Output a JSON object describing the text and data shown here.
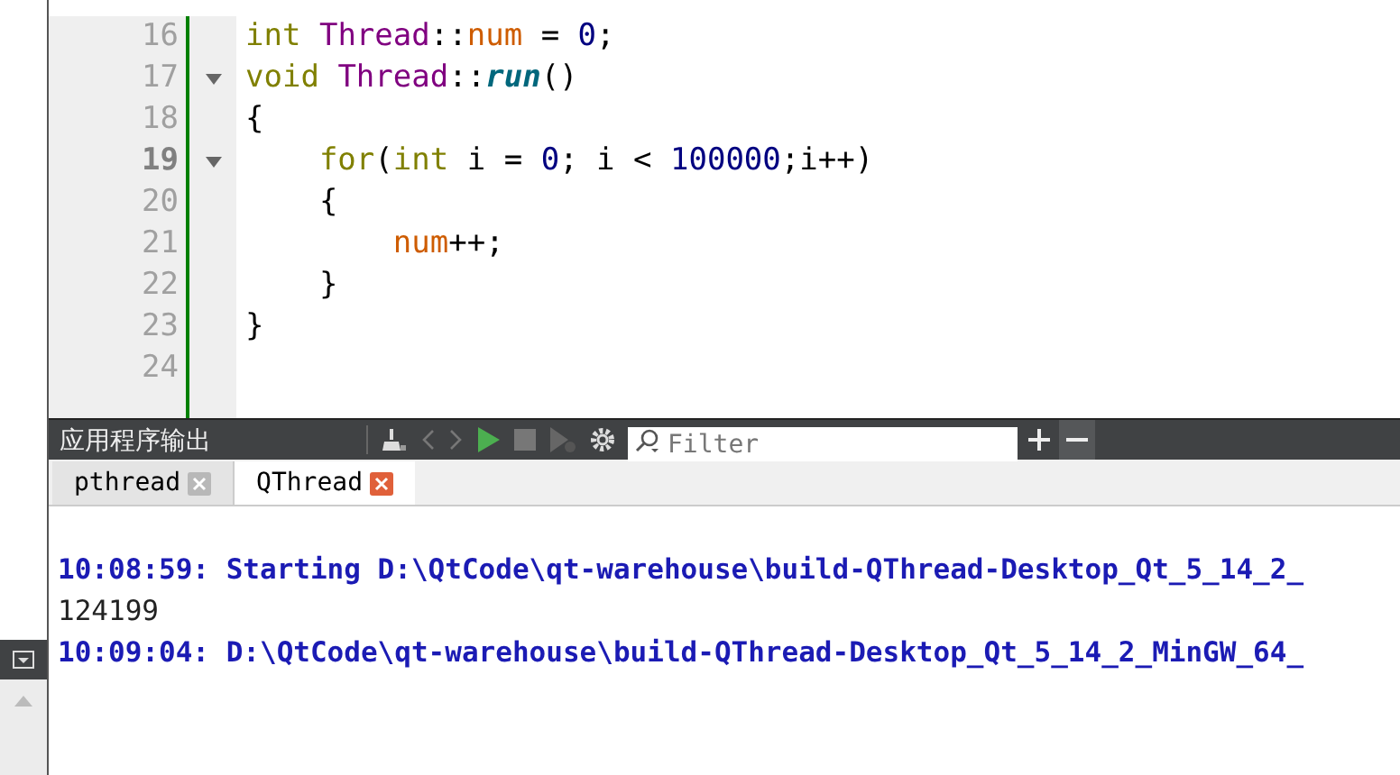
{
  "editor": {
    "lines": [
      {
        "number": "16",
        "current": false,
        "foldable": false,
        "tokens": [
          {
            "kind": "keyword",
            "text": "int"
          },
          {
            "kind": "class",
            "text": " Thread"
          },
          {
            "kind": "plain",
            "text": "::"
          },
          {
            "kind": "member",
            "text": "num"
          },
          {
            "kind": "plain",
            "text": " = "
          },
          {
            "kind": "number",
            "text": "0"
          },
          {
            "kind": "plain",
            "text": ";"
          }
        ]
      },
      {
        "number": "17",
        "current": false,
        "foldable": true,
        "tokens": [
          {
            "kind": "keyword",
            "text": "void"
          },
          {
            "kind": "class",
            "text": " Thread"
          },
          {
            "kind": "plain",
            "text": "::"
          },
          {
            "kind": "function",
            "text": "run"
          },
          {
            "kind": "plain",
            "text": "()"
          }
        ]
      },
      {
        "number": "18",
        "current": false,
        "foldable": false,
        "tokens": [
          {
            "kind": "plain",
            "text": "{"
          }
        ]
      },
      {
        "number": "19",
        "current": true,
        "foldable": true,
        "tokens": [
          {
            "kind": "keyword",
            "text": "    for"
          },
          {
            "kind": "plain",
            "text": "("
          },
          {
            "kind": "keyword",
            "text": "int"
          },
          {
            "kind": "plain",
            "text": " i = "
          },
          {
            "kind": "number",
            "text": "0"
          },
          {
            "kind": "plain",
            "text": "; i < "
          },
          {
            "kind": "number",
            "text": "100000"
          },
          {
            "kind": "plain",
            "text": ";i++)"
          }
        ]
      },
      {
        "number": "20",
        "current": false,
        "foldable": false,
        "tokens": [
          {
            "kind": "plain",
            "text": "    {"
          }
        ]
      },
      {
        "number": "21",
        "current": false,
        "foldable": false,
        "tokens": [
          {
            "kind": "member",
            "text": "        num"
          },
          {
            "kind": "plain",
            "text": "++;"
          }
        ]
      },
      {
        "number": "22",
        "current": false,
        "foldable": false,
        "tokens": [
          {
            "kind": "plain",
            "text": "    }"
          }
        ]
      },
      {
        "number": "23",
        "current": false,
        "foldable": false,
        "tokens": [
          {
            "kind": "plain",
            "text": "}"
          }
        ]
      },
      {
        "number": "24",
        "current": false,
        "foldable": false
      }
    ]
  },
  "output_pane": {
    "title": "应用程序输出",
    "filter": {
      "placeholder": "Filter"
    },
    "tabs": [
      {
        "label": "pthread",
        "selected": false
      },
      {
        "label": "QThread",
        "selected": true
      }
    ],
    "lines": [
      {
        "kind": "status",
        "text": "10:08:59: Starting D:\\QtCode\\qt-warehouse\\build-QThread-Desktop_Qt_5_14_2_"
      },
      {
        "kind": "program",
        "text": "124199"
      },
      {
        "kind": "status",
        "text": "10:09:04: D:\\QtCode\\qt-warehouse\\build-QThread-Desktop_Qt_5_14_2_MinGW_64_"
      }
    ]
  }
}
